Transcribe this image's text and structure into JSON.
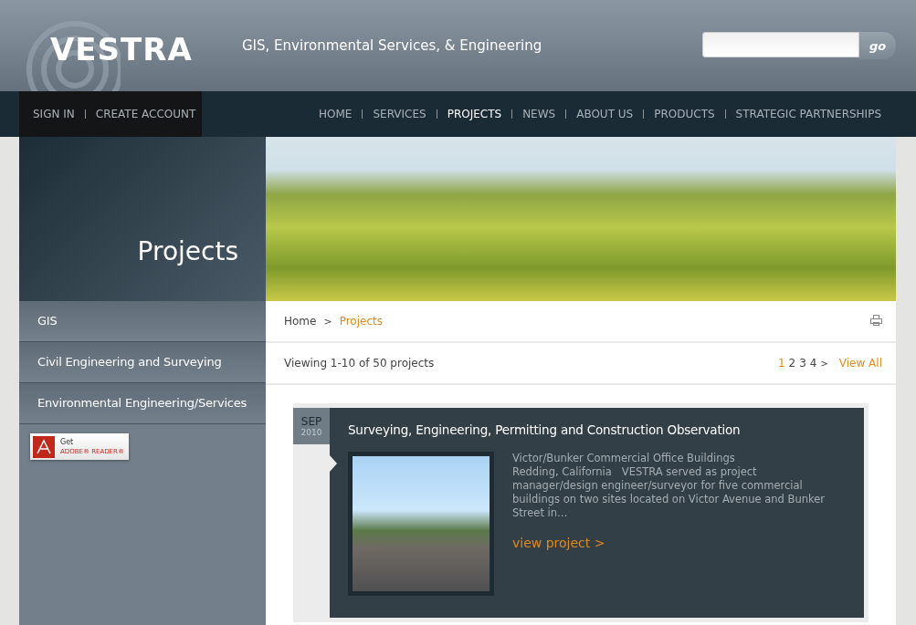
{
  "header": {
    "logo": "VESTRA",
    "tagline": "GIS, Environmental Services, & Engineering",
    "search": {
      "button": "go"
    }
  },
  "account_links": [
    "SIGN IN",
    "CREATE ACCOUNT"
  ],
  "nav": [
    {
      "label": "HOME",
      "selected": false
    },
    {
      "label": "SERVICES",
      "selected": false
    },
    {
      "label": "PROJECTS",
      "selected": true
    },
    {
      "label": "NEWS",
      "selected": false
    },
    {
      "label": "ABOUT US",
      "selected": false
    },
    {
      "label": "PRODUCTS",
      "selected": false
    },
    {
      "label": "STRATEGIC PARTNERSHIPS",
      "selected": false
    }
  ],
  "page_title": "Projects",
  "sidebar": {
    "items": [
      "GIS",
      "Civil Engineering and Surveying",
      "Environmental Engineering/Services"
    ],
    "badge": {
      "line_1": "Get",
      "line_2": "ADOBE® READER®"
    }
  },
  "breadcrumb": [
    {
      "label": "Home",
      "selected": false
    },
    {
      "label": "Projects",
      "selected": true
    }
  ],
  "breadcrumb_separator": ">",
  "viewing": "Viewing 1-10 of 50 projects",
  "pagination": {
    "pages": [
      {
        "label": "1",
        "selected": true
      },
      {
        "label": "2",
        "selected": false
      },
      {
        "label": "3",
        "selected": false
      },
      {
        "label": "4",
        "selected": false
      }
    ],
    "next": ">",
    "view_all": "View All"
  },
  "projects": [
    {
      "month": "SEP",
      "year": "2010",
      "title": "Surveying, Engineering, Permitting and Construction Observation",
      "description_lines": [
        "Victor/Bunker Commercial Office Buildings",
        "Redding, California   VESTRA served as project manager/design engineer/surveyor for five commercial buildings on two sites located on Victor Avenue and Bunker Street in…"
      ],
      "link": "view project >"
    }
  ]
}
